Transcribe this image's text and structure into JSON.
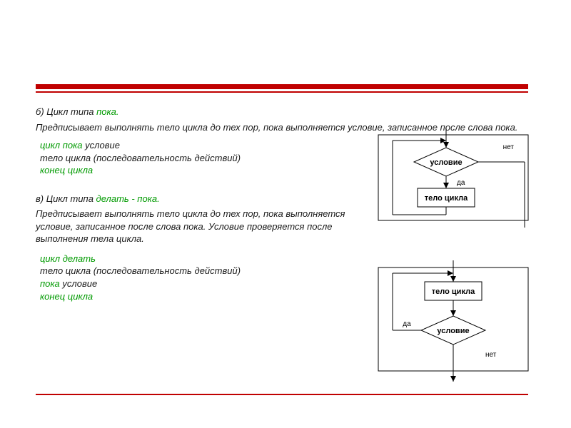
{
  "section_b": {
    "label_prefix": "б) Цикл типа ",
    "label_keyword": "пока.",
    "description": "Предписывает выполнять тело цикла до тех пор, пока выполняется условие, записанное после слова пока.",
    "pseudo": {
      "l1_kw": "цикл пока",
      "l1_rest": " условие",
      "l2": "тело цикла (последовательность действий)",
      "l3_kw": "конец цикла"
    }
  },
  "section_v": {
    "label_prefix": "в) Цикл типа ",
    "label_keyword": "делать - пока.",
    "description": "Предписывает выполнять тело цикла до тех пор, пока выполняется условие, записанное после слова пока. Условие проверяется после выполнения тела цикла.",
    "pseudo": {
      "l1_kw": "цикл делать",
      "l2": "тело цикла (последовательность действий)",
      "l3_kw": "пока",
      "l3_rest": " условие",
      "l4_kw": "конец цикла"
    }
  },
  "flow": {
    "condition": "условие",
    "body": "тело цикла",
    "yes": "да",
    "no": "нет"
  }
}
